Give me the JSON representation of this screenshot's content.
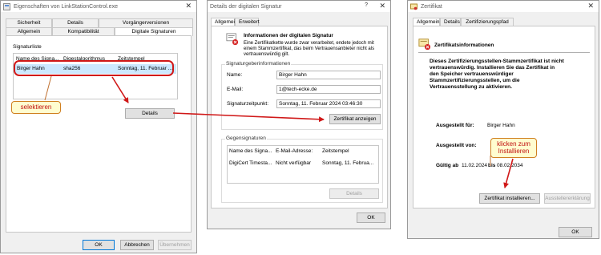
{
  "w1": {
    "title": "Eigenschaften von LinkStationControl.exe",
    "tabs_row1": [
      "Sicherheit",
      "Details",
      "Vorgängerversionen"
    ],
    "tabs_row2": [
      "Allgemein",
      "Kompatibilität",
      "Digitale Signaturen"
    ],
    "group": "Signaturliste",
    "columns": [
      "Name des Signa...",
      "Digestalgorithmus",
      "Zeitstempel"
    ],
    "row": [
      "Birger Hahn",
      "sha256",
      "Sonntag, 11. Februar ..."
    ],
    "details_btn": "Details",
    "ok": "OK",
    "cancel": "Abbrechen",
    "apply": "Übernehmen"
  },
  "w2": {
    "title": "Details der digitalen Signatur",
    "help": "?",
    "tabs": [
      "Allgemein",
      "Erweitert"
    ],
    "info_title": "Informationen der digitalen Signatur",
    "info_text": [
      "Eine Zertifikatkette wurde zwar verarbeitet, endete jedoch mit",
      "einem Stammzertifikat, das beim Vertrauensanbieter nicht als",
      "vertrauenswürdig gilt."
    ],
    "signer_group": "Signaturgeberinformationen",
    "name_label": "Name:",
    "name_value": "Birger Hahn",
    "email_label": "E-Mail:",
    "email_value": "1@tech-ecke.de",
    "time_label": "Signaturzeitpunkt:",
    "time_value": "Sonntag, 11. Februar 2024 03:46:30",
    "show_cert_btn": "Zertifikat anzeigen",
    "counter_group": "Gegensignaturen",
    "columns": [
      "Name des Signa...",
      "E-Mail-Adresse:",
      "Zeitstempel"
    ],
    "row": [
      "DigiCert Timesta...",
      "Nicht verfügbar",
      "Sonntag, 11. Februa..."
    ],
    "details_btn": "Details",
    "ok": "OK"
  },
  "w3": {
    "title": "Zertifikat",
    "tabs": [
      "Allgemein",
      "Details",
      "Zertifizierungspfad"
    ],
    "info_title": "Zertifikatsinformationen",
    "warning": [
      "Dieses Zertifizierungsstellen-Stammzertifikat ist nicht",
      "vertrauenswürdig. Installieren Sie das Zertifikat in",
      "den Speicher vertrauenswürdiger",
      "Stammzertifizierungsstellen, um die",
      "Vertrauensstellung zu aktivieren."
    ],
    "issued_to_label": "Ausgestellt für:",
    "issued_to_value": "Birger Hahn",
    "issued_by_label": "Ausgestellt von:",
    "valid_label": "Gültig ab",
    "valid_from": "11.02.2024",
    "valid_bis": "bis",
    "valid_to": "08.02.2034",
    "install_btn": "Zertifikat installieren...",
    "issuer_btn": "Ausstellererklärung",
    "ok": "OK"
  },
  "callouts": {
    "select": "selektieren",
    "install_line1": "klicken zum",
    "install_line2": "Installieren"
  },
  "colors": {
    "accent": "#0078d7",
    "annotation_red": "#d01818",
    "callout_bg": "#fffdd0"
  }
}
